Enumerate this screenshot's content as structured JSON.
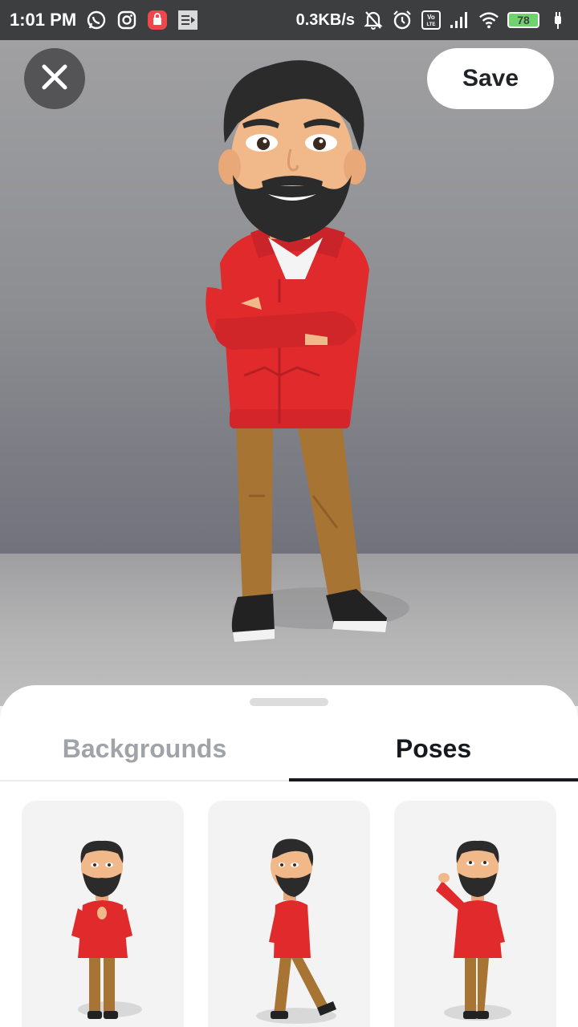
{
  "status_bar": {
    "time": "1:01 PM",
    "network_speed": "0.3KB/s",
    "battery_level": "78",
    "icons": [
      "whatsapp-icon",
      "instagram-icon",
      "shopping-bag-icon",
      "notes-icon",
      "mute-bell-icon",
      "alarm-icon",
      "volte-icon",
      "signal-icon",
      "wifi-icon",
      "battery-icon",
      "charging-icon"
    ]
  },
  "header": {
    "close_icon": "close-icon",
    "save_label": "Save"
  },
  "tabs": [
    {
      "label": "Backgrounds",
      "active": false
    },
    {
      "label": "Poses",
      "active": true
    }
  ],
  "poses": [
    {
      "name": "hands-together"
    },
    {
      "name": "walking"
    },
    {
      "name": "saluting"
    }
  ],
  "colors": {
    "accent": "#16191d",
    "hoodie": "#e02a2c",
    "pants": "#a87434",
    "inactive_tab": "#a0a3a8"
  }
}
